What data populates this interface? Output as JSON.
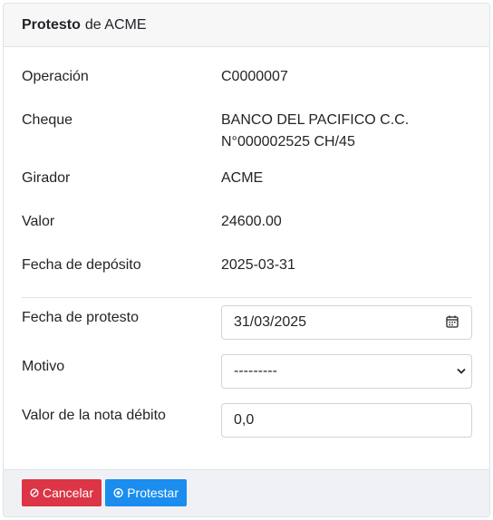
{
  "header": {
    "title_bold": "Protesto",
    "title_rest": "de ACME"
  },
  "details": {
    "operacion": {
      "label": "Operación",
      "value": "C0000007"
    },
    "cheque": {
      "label": "Cheque",
      "value_line1": "BANCO DEL PACIFICO C.C.",
      "value_line2": "N°000002525 CH/45"
    },
    "girador": {
      "label": "Girador",
      "value": "ACME"
    },
    "valor": {
      "label": "Valor",
      "value": "24600.00"
    },
    "fecha_deposito": {
      "label": "Fecha de depósito",
      "value": "2025-03-31"
    }
  },
  "form": {
    "fecha_protesto": {
      "label": "Fecha de protesto",
      "value": "31/03/2025"
    },
    "motivo": {
      "label": "Motivo",
      "value": "---------"
    },
    "valor_nota": {
      "label": "Valor de la nota débito",
      "value": "0,0"
    }
  },
  "footer": {
    "cancel_label": "Cancelar",
    "protest_label": "Protestar"
  },
  "colors": {
    "cancel": "#dc3545",
    "protest": "#1a8dee"
  },
  "icons": {
    "date": "calendar-icon",
    "select": "chevron-down-icon",
    "cancel": "ban-icon",
    "protest": "dot-circle-icon"
  }
}
